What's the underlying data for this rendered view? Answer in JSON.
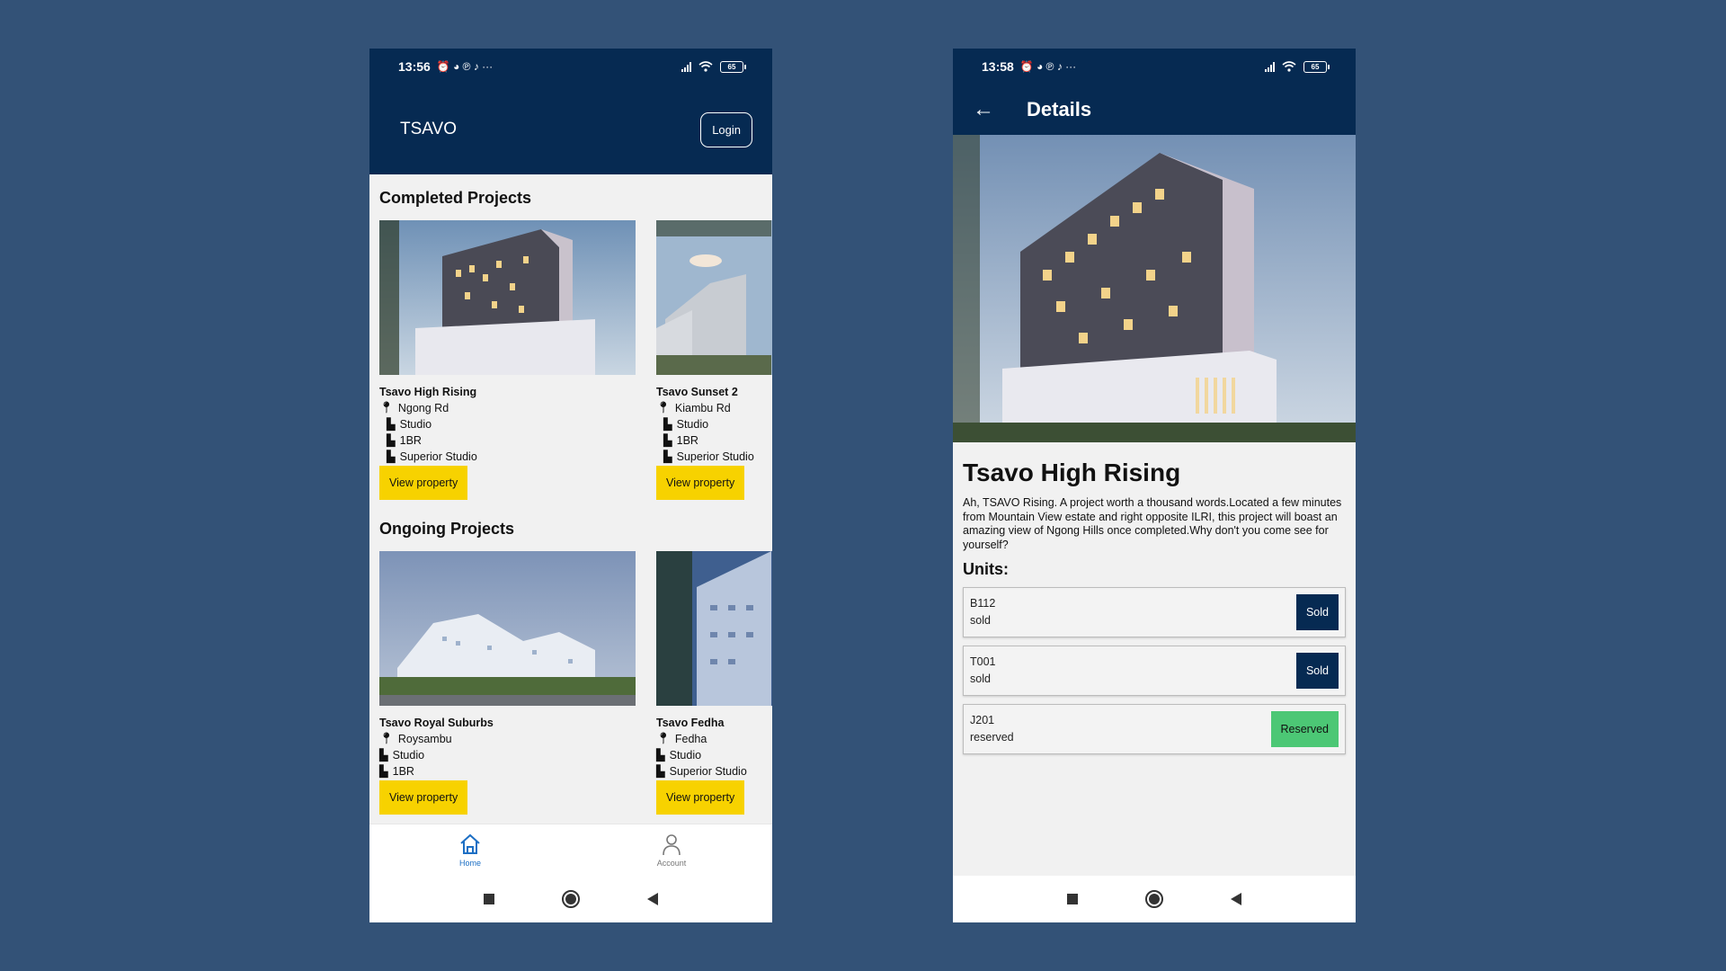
{
  "home": {
    "status": {
      "time": "13:56",
      "battery": "65"
    },
    "header": {
      "brand": "TSAVO",
      "login_label": "Login"
    },
    "completed_title": "Completed Projects",
    "completed": [
      {
        "name": "Tsavo High Rising",
        "location": "Ngong Rd",
        "units": [
          "Studio",
          "1BR",
          "Superior Studio"
        ],
        "button": "View property"
      },
      {
        "name": "Tsavo Sunset 2",
        "location": "Kiambu Rd",
        "units": [
          "Studio",
          "1BR",
          "Superior Studio"
        ],
        "button": "View property"
      }
    ],
    "ongoing_title": "Ongoing Projects",
    "ongoing": [
      {
        "name": "Tsavo Royal Suburbs",
        "location": "Roysambu",
        "units": [
          "Studio",
          "1BR"
        ],
        "button": "View property"
      },
      {
        "name": "Tsavo Fedha",
        "location": "Fedha",
        "units": [
          "Studio",
          "Superior Studio"
        ],
        "button": "View property"
      }
    ],
    "nav": {
      "home": "Home",
      "account": "Account"
    }
  },
  "details": {
    "status": {
      "time": "13:58",
      "battery": "65"
    },
    "header_title": "Details",
    "name": "Tsavo High Rising",
    "description": "Ah, TSAVO Rising. A project worth a thousand words.Located a few minutes from Mountain View estate and right opposite ILRI, this project will boast an amazing view of Ngong Hills once completed.Why don't you come see for yourself?",
    "units_label": "Units:",
    "units": [
      {
        "code": "B112",
        "state": "sold",
        "button": "Sold"
      },
      {
        "code": "T001",
        "state": "sold",
        "button": "Sold"
      },
      {
        "code": "J201",
        "state": "reserved",
        "button": "Reserved"
      }
    ]
  },
  "colors": {
    "primary": "#062a52",
    "accent": "#f7d200",
    "reserved": "#4cc775",
    "background": "#335277"
  }
}
